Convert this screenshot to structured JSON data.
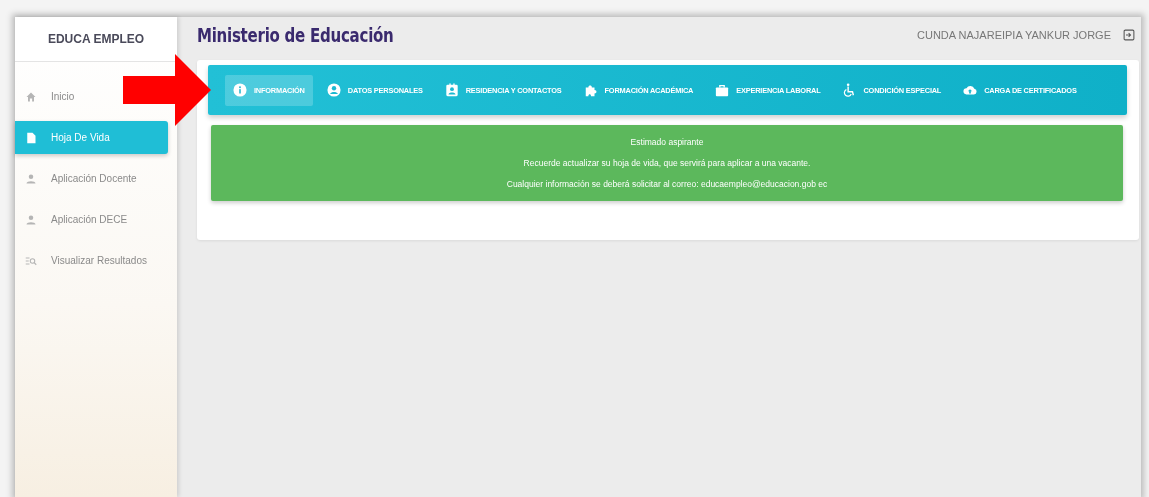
{
  "sidebar": {
    "title": "EDUCA EMPLEO",
    "items": [
      {
        "label": "Inicio",
        "selected": false
      },
      {
        "label": "Hoja De Vida",
        "selected": true
      },
      {
        "label": "Aplicación Docente",
        "selected": false
      },
      {
        "label": "Aplicación DECE",
        "selected": false
      },
      {
        "label": "Visualizar Resultados",
        "selected": false
      }
    ]
  },
  "header": {
    "title": "Ministerio de Educación",
    "user": "CUNDA NAJAREIPIA YANKUR JORGE"
  },
  "tabs": [
    {
      "label": "INFORMACIÓN",
      "selected": true
    },
    {
      "label": "DATOS PERSONALES",
      "selected": false
    },
    {
      "label": "RESIDENCIA Y CONTACTOS",
      "selected": false
    },
    {
      "label": "FORMACIÓN ACADÉMICA",
      "selected": false
    },
    {
      "label": "EXPERIENCIA LABORAL",
      "selected": false
    },
    {
      "label": "CONDICIÓN ESPECIAL",
      "selected": false
    },
    {
      "label": "CARGA DE CERTIFICADOS",
      "selected": false
    }
  ],
  "alert": {
    "lines": [
      "Estimado aspirante",
      "Recuerde actualizar su hoja de vida, que servirá para aplicar a una vacante.",
      "Cualquier información se deberá solicitar al correo: educaempleo@educacion.gob ec"
    ]
  }
}
